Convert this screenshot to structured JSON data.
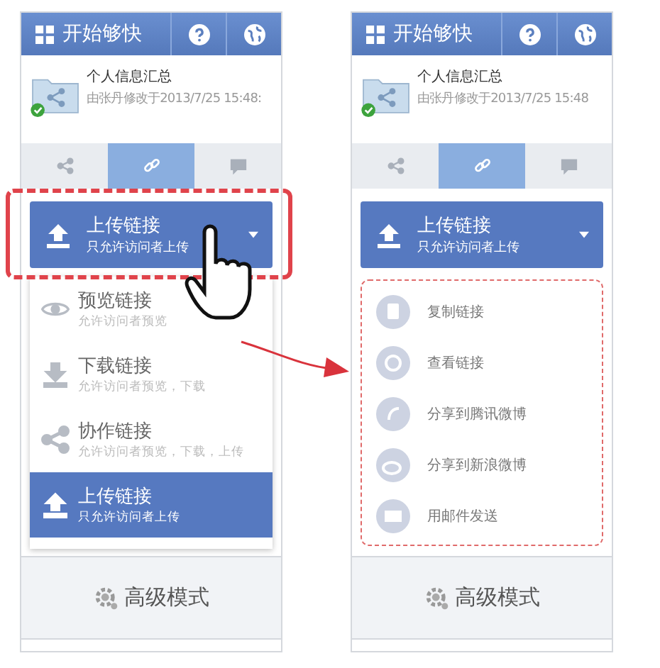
{
  "panels": [
    {
      "header": {
        "title": "开始够快"
      },
      "file": {
        "name": "个人信息汇总",
        "meta": "由张丹修改于2013/7/25 15:48:"
      },
      "tabs": [
        {
          "selected": false
        },
        {
          "selected": true
        },
        {
          "selected": false
        }
      ],
      "dropdown": {
        "title": "上传链接",
        "subtitle": "只允许访问者上传"
      },
      "content": {
        "kind": "menu",
        "items": [
          {
            "title": "预览链接",
            "subtitle": "允许访问者预览",
            "selected": false
          },
          {
            "title": "下载链接",
            "subtitle": "允许访问者预览，下载",
            "selected": false
          },
          {
            "title": "协作链接",
            "subtitle": "允许访问者预览，下载，上传",
            "selected": false
          },
          {
            "title": "上传链接",
            "subtitle": "只允许访问者上传",
            "selected": true
          }
        ]
      },
      "footer": "高级模式"
    },
    {
      "header": {
        "title": "开始够快"
      },
      "file": {
        "name": "个人信息汇总",
        "meta": "由张丹修改于2013/7/25 15:48"
      },
      "tabs": [
        {
          "selected": false
        },
        {
          "selected": true
        },
        {
          "selected": false
        }
      ],
      "dropdown": {
        "title": "上传链接",
        "subtitle": "只允许访问者上传"
      },
      "content": {
        "kind": "actions",
        "items": [
          {
            "label": "复制链接"
          },
          {
            "label": "查看链接"
          },
          {
            "label": "分享到腾讯微博"
          },
          {
            "label": "分享到新浪微博"
          },
          {
            "label": "用邮件发送"
          }
        ]
      },
      "footer": "高级模式"
    }
  ]
}
